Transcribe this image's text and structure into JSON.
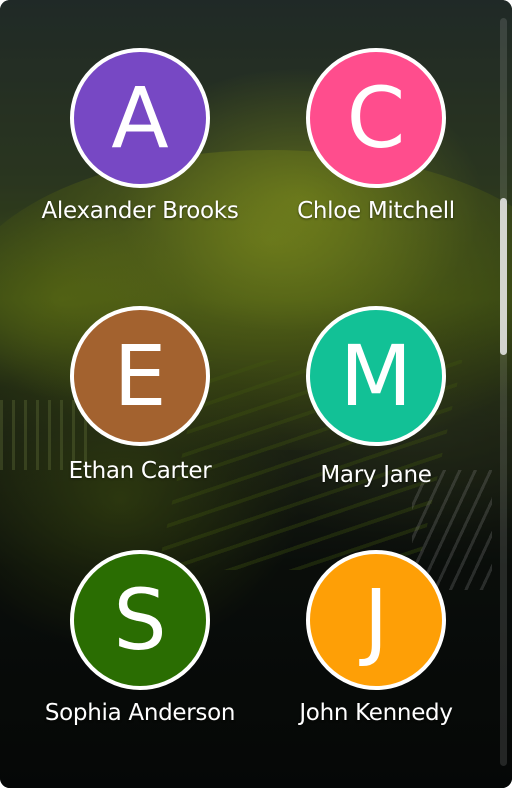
{
  "contacts": [
    {
      "initial": "A",
      "name": "Alexander Brooks",
      "color": "#7748c4"
    },
    {
      "initial": "C",
      "name": "Chloe Mitchell",
      "color": "#ff4d8d"
    },
    {
      "initial": "E",
      "name": "Ethan Carter",
      "color": "#a3622f"
    },
    {
      "initial": "M",
      "name": "Mary Jane",
      "color": "#12c196"
    },
    {
      "initial": "S",
      "name": "Sophia Anderson",
      "color": "#2a6d02"
    },
    {
      "initial": "J",
      "name": "John Kennedy",
      "color": "#fe9f06"
    }
  ],
  "scroll": {
    "position_fraction": 0.24,
    "visible_fraction": 0.21
  },
  "theme": {
    "avatar_border": "#ffffff",
    "text": "#ffffff"
  }
}
